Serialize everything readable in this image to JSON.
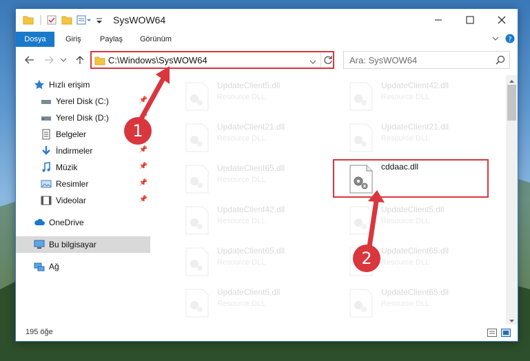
{
  "window": {
    "title": "SysWOW64"
  },
  "ribbon": {
    "tabs": [
      "Dosya",
      "Giriş",
      "Paylaş",
      "Görünüm"
    ]
  },
  "address": {
    "path": "C:\\Windows\\SysWOW64"
  },
  "search": {
    "placeholder": "Ara: SysWOW64"
  },
  "sidebar": {
    "items": [
      {
        "label": "Hızlı erişim",
        "icon": "star-icon"
      },
      {
        "label": "Yerel Disk (C:)",
        "icon": "drive-icon"
      },
      {
        "label": "Yerel Disk (D:)",
        "icon": "drive-icon"
      },
      {
        "label": "Belgeler",
        "icon": "document-icon"
      },
      {
        "label": "İndirmeler",
        "icon": "download-icon"
      },
      {
        "label": "Müzik",
        "icon": "music-icon"
      },
      {
        "label": "Resimler",
        "icon": "pictures-icon"
      },
      {
        "label": "Videolar",
        "icon": "video-icon"
      },
      {
        "label": "OneDrive",
        "icon": "cloud-icon"
      },
      {
        "label": "Bu bilgisayar",
        "icon": "computer-icon"
      },
      {
        "label": "Ağ",
        "icon": "network-icon"
      }
    ]
  },
  "files": {
    "left": [
      {
        "name": "UpdateClient5.dll",
        "desc": "Resource DLL"
      },
      {
        "name": "UpdateClient21.dll",
        "desc": "Resource DLL"
      },
      {
        "name": "UpdateClient65.dll",
        "desc": "Resource DLL"
      },
      {
        "name": "UpdateClient42.dll",
        "desc": "Resource DLL"
      },
      {
        "name": "UpdateClient65.dll",
        "desc": "Resource DLL"
      },
      {
        "name": "UpdateClient5.dll",
        "desc": "Resource DLL"
      }
    ],
    "right": [
      {
        "name": "UpdateClient42.dll",
        "desc": "Resource DLL"
      },
      {
        "name": "UpdateClient21.dll",
        "desc": "Resource DLL"
      },
      {
        "name": "cddaac.dll",
        "desc": ""
      },
      {
        "name": "UpdateClient5.dll",
        "desc": "Resource DLL"
      },
      {
        "name": "UpdateClient65.dll",
        "desc": "Resource DLL"
      },
      {
        "name": "UpdateClient65.dll",
        "desc": "Resource DLL"
      }
    ]
  },
  "status": {
    "count": "195 öğe"
  },
  "annotations": {
    "step1": "1",
    "step2": "2"
  },
  "colors": {
    "accent": "#1979ca",
    "highlight": "#d9363e"
  }
}
